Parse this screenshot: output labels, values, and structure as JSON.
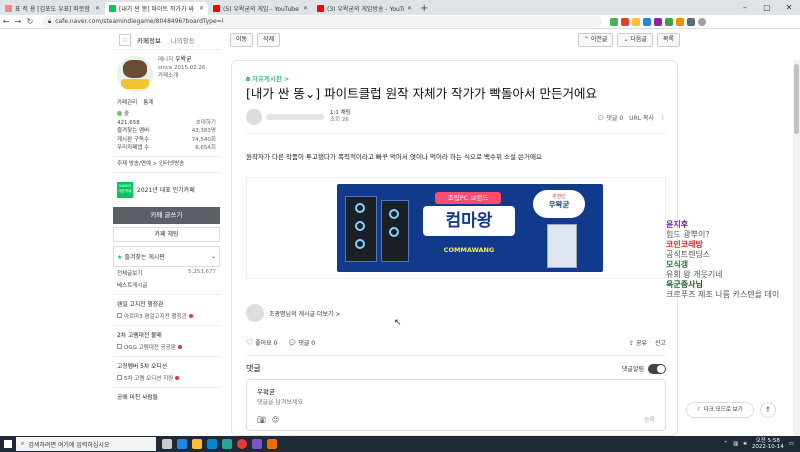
{
  "browser": {
    "tabs": [
      {
        "title": "표 적 용 [김포도 우표] 따뜻함 ",
        "color": "#f28b82",
        "active": false
      },
      {
        "title": "[내가 싼 똥] 파이트 작가가 싸",
        "color": "#03c75a",
        "active": true
      },
      {
        "title": "(5) 우왁굳의 게임 - YouTube",
        "color": "#ff0000",
        "active": false
      },
      {
        "title": "(3) 우왁굳의 게임방송 - YouTub",
        "color": "#ff0000",
        "active": false
      }
    ],
    "new_tab": "+",
    "url": "cafe.naver.com/steamindiegame/8048496?boardType=l"
  },
  "sidebar": {
    "tab_info": "카페정보",
    "tab_my": "나의활동",
    "manager_label": "매니저",
    "manager_name": "우왁굳",
    "since": "since 2015.02.26.",
    "intro": "카페소개",
    "link_manage": "카페관리",
    "link_stats": "통계",
    "rank": "숲",
    "members": "421,658",
    "invite": "초대하기",
    "stats": [
      {
        "label": "즐겨찾는 멤버",
        "value": "43,383명"
      },
      {
        "label": "게시판 구독수",
        "value": "74,540회"
      },
      {
        "label": "우리카페앱 수",
        "value": "6,654회"
      }
    ],
    "theme": "주제  방송/연예 > 인터넷방송",
    "award_badge": "NAVER 대표카페",
    "award_text": "2021년 대표 인기카페",
    "write_button": "카페 글쓰기",
    "chat_button": "카페 채팅",
    "boards_header": "즐겨찾는 게시판",
    "boards": [
      {
        "label": "전체글보기",
        "count": "5,253,677"
      },
      {
        "label": "베스트게시글",
        "count": ""
      }
    ],
    "sections": [
      {
        "title": "왠일 고지전 행정관",
        "sub": "아르마3 왠일고지전 행정관"
      },
      {
        "title": "2차 고멤대전 불매",
        "sub": "OGG 고멤대전 공공판"
      },
      {
        "title": "고정멤버 5차 오디션",
        "sub": "5차 고멤 오디션 지원"
      },
      {
        "title": "공에 미친 사람들",
        "sub": ""
      }
    ]
  },
  "toolbar": {
    "move": "이동",
    "delete": "삭제",
    "prev": "이전글",
    "next": "다음글",
    "list": "목록"
  },
  "article": {
    "board": "자유게시판 >",
    "title": "[내가 싼 똥⌄] 파이트클럽 원작 자체가 작가가 빡돌아서 만든거에요",
    "level": "1:1 채팅",
    "views": "조회 26",
    "comments_label": "댓글 0",
    "url_copy": "URL 복사",
    "body": "원작자가 다른 작품이 투고됐다가 폭력적이라고 빠꾸 먹어서 엿이나 먹어라 하는 식으로 백수위 소설 쓴거에요",
    "banner_top": "조립PC 브랜드",
    "banner_main": "컴마왕",
    "banner_brand": "COMMAWANG",
    "banner_rec_small": "추천인",
    "banner_rec_big": "우왁굳",
    "writer_link": "조광명님의 게시글 더보기 >",
    "likes": "좋아요 0",
    "comments": "댓글 0",
    "share": "공유",
    "report": "신고",
    "comment_header": "댓글",
    "comment_alert": "댓글알림",
    "comment_user": "우왁굳",
    "comment_placeholder": "댓글을 남겨보세요",
    "comment_submit": "등록"
  },
  "live_chat": [
    {
      "name": "윤지후",
      "text": "힘드 광뿌이?",
      "color": "#7b1fa2"
    },
    {
      "name": "코인코레방",
      "text": "공식트렌딩스",
      "color": "#d32f2f"
    },
    {
      "name": "모식갱",
      "text": "유회 왕 개웃기네",
      "color": "#2e7d32"
    },
    {
      "name": "옥군중사님",
      "text": "크르푸즈 제조 나름 카스텐을 데이",
      "color": "#1b5e20"
    }
  ],
  "floating": {
    "dark_mode": "다크 모드로 보기",
    "top": "↑"
  },
  "taskbar": {
    "search": "검색하려면 여기에 입력하십시오",
    "time": "오전 5:58",
    "date": "2022-10-14"
  },
  "colors": {
    "naver_green": "#03c75a",
    "banner_blue": "#123a8c",
    "taskbar": "#1f2a36"
  }
}
